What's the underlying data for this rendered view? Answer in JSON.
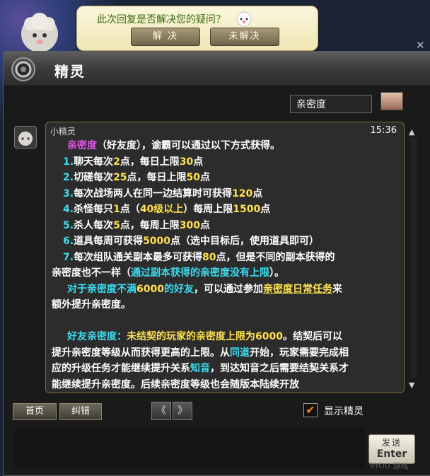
{
  "feedback": {
    "question": "此次回复是否解决您的疑问？",
    "yes_label": "解 决",
    "no_label": "未解决"
  },
  "window": {
    "title": "精灵"
  },
  "tab": {
    "label": "亲密度"
  },
  "message": {
    "sender": "小精灵",
    "time": "15:36",
    "lines": [
      [
        {
          "t": "亲密度",
          "c": "mg"
        },
        {
          "t": "（好友度），谕霸可以通过以下方式获得。",
          "c": ""
        }
      ],
      [
        {
          "t": "1.",
          "c": "cy"
        },
        {
          "t": "聊天每次",
          "c": ""
        },
        {
          "t": "2",
          "c": "yl"
        },
        {
          "t": "点，每日上限",
          "c": ""
        },
        {
          "t": "30",
          "c": "yl"
        },
        {
          "t": "点",
          "c": ""
        }
      ],
      [
        {
          "t": "2.",
          "c": "cy"
        },
        {
          "t": "切磋每次",
          "c": ""
        },
        {
          "t": "25",
          "c": "yl"
        },
        {
          "t": "点，每日上限",
          "c": ""
        },
        {
          "t": "50",
          "c": "yl"
        },
        {
          "t": "点",
          "c": ""
        }
      ],
      [
        {
          "t": "3.",
          "c": "cy"
        },
        {
          "t": "每次战场两人在同一边结算时可获得",
          "c": ""
        },
        {
          "t": "120",
          "c": "yl"
        },
        {
          "t": "点",
          "c": ""
        }
      ],
      [
        {
          "t": "4.",
          "c": "cy"
        },
        {
          "t": "杀怪每只",
          "c": ""
        },
        {
          "t": "1",
          "c": "yl"
        },
        {
          "t": "点（",
          "c": ""
        },
        {
          "t": "40级以上",
          "c": "yl"
        },
        {
          "t": "）每周上限",
          "c": ""
        },
        {
          "t": "1500",
          "c": "yl"
        },
        {
          "t": "点",
          "c": ""
        }
      ],
      [
        {
          "t": "5.",
          "c": "cy"
        },
        {
          "t": "杀人每次",
          "c": ""
        },
        {
          "t": "5",
          "c": "yl"
        },
        {
          "t": "点，每周上限",
          "c": ""
        },
        {
          "t": "300",
          "c": "yl"
        },
        {
          "t": "点",
          "c": ""
        }
      ],
      [
        {
          "t": "6.",
          "c": "cy"
        },
        {
          "t": "道具每周可获得",
          "c": ""
        },
        {
          "t": "5000",
          "c": "yl"
        },
        {
          "t": "点（选中目标后，使用道具即可）",
          "c": ""
        }
      ],
      [
        {
          "t": "7.",
          "c": "cy"
        },
        {
          "t": "每次组队通关副本最多可获得",
          "c": ""
        },
        {
          "t": "80",
          "c": "yl"
        },
        {
          "t": "点，但是不同的副本获得的",
          "c": ""
        }
      ],
      [
        {
          "t": "亲密度也不一样（",
          "c": ""
        },
        {
          "t": "通过副本获得的亲密度没有上限",
          "c": "cy"
        },
        {
          "t": "）。",
          "c": ""
        }
      ],
      [
        {
          "t": "对于亲密度不满",
          "c": "cy"
        },
        {
          "t": "6000",
          "c": "yl"
        },
        {
          "t": "的好友",
          "c": "cy"
        },
        {
          "t": "，可以通过参加",
          "c": ""
        },
        {
          "t": "亲密度日常任务",
          "c": "yl ul"
        },
        {
          "t": "来",
          "c": ""
        }
      ],
      [
        {
          "t": "额外提升亲密度。",
          "c": ""
        }
      ],
      [
        {
          "t": "",
          "c": ""
        }
      ],
      [
        {
          "t": "好友亲密度：",
          "c": "cy"
        },
        {
          "t": "未结契的玩家的亲密度上限为6000",
          "c": "yl"
        },
        {
          "t": "。结契后可以",
          "c": ""
        }
      ],
      [
        {
          "t": "提升亲密度等级从而获得更高的上限。从",
          "c": ""
        },
        {
          "t": "同道",
          "c": "cy"
        },
        {
          "t": "开始，玩家需要完成相",
          "c": ""
        }
      ],
      [
        {
          "t": "应的升级任务才能继续提升关系",
          "c": ""
        },
        {
          "t": "知音",
          "c": "cy"
        },
        {
          "t": "，到达知音之后需要结契关系才",
          "c": ""
        }
      ],
      [
        {
          "t": "能继续提升亲密度。后续亲密度等级也会随版本陆续开放",
          "c": ""
        }
      ]
    ]
  },
  "controls": {
    "home_label": "首页",
    "fix_label": "纠错",
    "prev_label": "《",
    "next_label": "》",
    "show_sprite_label": "显示精灵",
    "show_sprite_checked": true,
    "send_label": "发送",
    "send_key": "Enter"
  },
  "watermark": "9YOU 游戏"
}
